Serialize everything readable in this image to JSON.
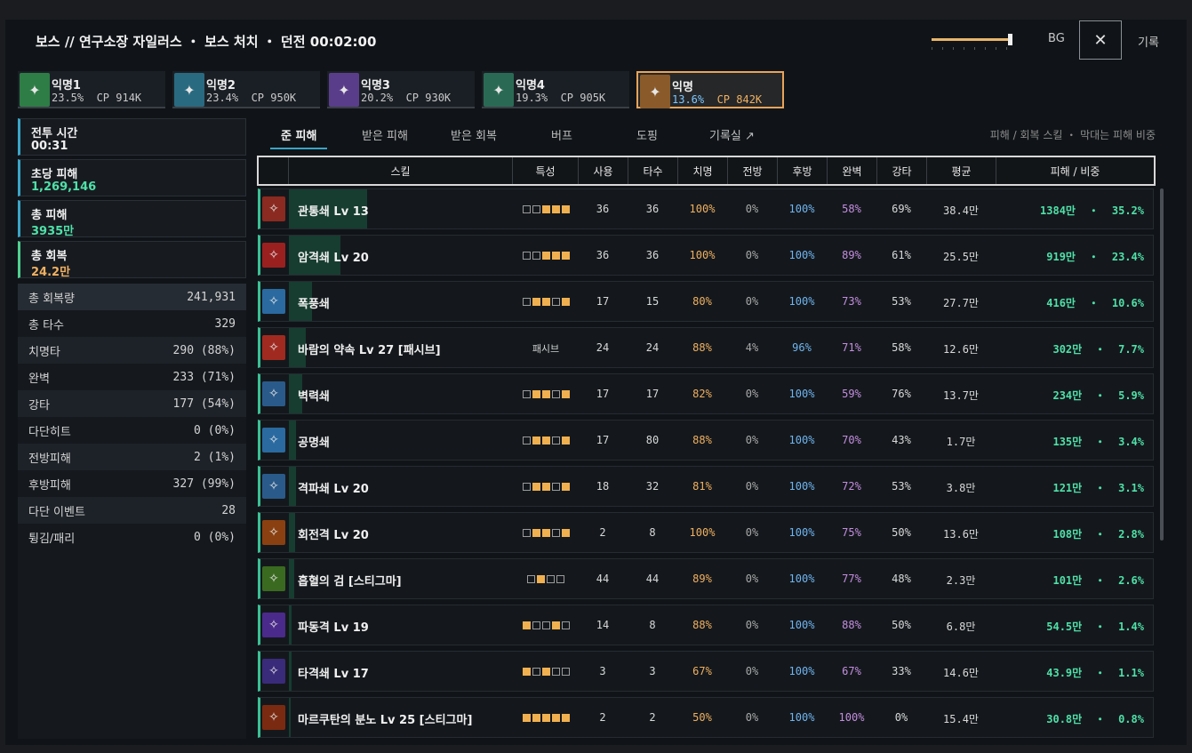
{
  "header": {
    "title": "보스 // 연구소장 자일러스 ・ 보스 처치 ・ 던전 00:02:00",
    "bg_label": "BG",
    "close_glyph": "✕",
    "record_label": "기록",
    "bg_slider_value": 0.95
  },
  "players": [
    {
      "name": "익명1",
      "stats": "23.5%  CP 914K",
      "color": "#2e7d46",
      "icon": "crest-icon"
    },
    {
      "name": "익명2",
      "stats": "23.4%  CP 950K",
      "color": "#2a6a80",
      "icon": "crest-icon"
    },
    {
      "name": "익명3",
      "stats": "20.2%  CP 930K",
      "color": "#5a3d8a",
      "icon": "crest-icon"
    },
    {
      "name": "익명4",
      "stats": "19.3%  CP 905K",
      "color": "#2a6a55",
      "icon": "crest-icon"
    },
    {
      "name": "익명",
      "pct": "13.6%",
      "cp": "CP 842K",
      "color": "#8a5a2a",
      "icon": "crest-icon",
      "selected": true
    }
  ],
  "summary": [
    {
      "label": "전투 시간",
      "value": "00:31",
      "color": "#f0f0f0",
      "accent": "#3aa5c8"
    },
    {
      "label": "초당 피해",
      "value": "1,269,146",
      "color": "#4fe0a8",
      "accent": "#3aa5c8"
    },
    {
      "label": "총 피해",
      "value": "3935만",
      "color": "#4fe0a8",
      "accent": "#3aa5c8"
    },
    {
      "label": "총 회복",
      "value": "24.2만",
      "color": "#f0b060",
      "accent": "#4fcf90"
    }
  ],
  "stats": [
    {
      "label": "총 회복량",
      "value": "241,931"
    },
    {
      "label": "총 타수",
      "value": "329"
    },
    {
      "label": "치명타",
      "value": "290 (88%)"
    },
    {
      "label": "완벽",
      "value": "233 (71%)"
    },
    {
      "label": "강타",
      "value": "177 (54%)"
    },
    {
      "label": "다단히트",
      "value": "0 (0%)"
    },
    {
      "label": "전방피해",
      "value": "2 (1%)"
    },
    {
      "label": "후방피해",
      "value": "327 (99%)"
    },
    {
      "label": "다단 이벤트",
      "value": "28"
    },
    {
      "label": "튕김/패리",
      "value": "0 (0%)"
    }
  ],
  "tabs": [
    "준 피해",
    "받은 피해",
    "받은 회복",
    "버프",
    "도핑",
    "기록실 ↗"
  ],
  "tab_right": "피해 / 회복 스킬  ・  막대는 피해 비중",
  "columns": [
    "스킬",
    "특성",
    "사용",
    "타수",
    "치명",
    "전방",
    "후방",
    "완벽",
    "강타",
    "평균",
    "피해 / 비중"
  ],
  "skills": [
    {
      "name": "관통쇄   Lv 13",
      "trait": [
        0,
        0,
        1,
        1,
        1
      ],
      "use": "36",
      "hits": "36",
      "crit": "100%",
      "front": "0%",
      "back": "100%",
      "perfect": "58%",
      "strong": "69%",
      "avg": "38.4만",
      "dmg": "1384만  ・  35.2%",
      "share": 35.2,
      "iconColor": "#8a2a20",
      "icon": "slash-icon"
    },
    {
      "name": "암격쇄   Lv 20",
      "trait": [
        0,
        0,
        1,
        1,
        1
      ],
      "use": "36",
      "hits": "36",
      "crit": "100%",
      "front": "0%",
      "back": "100%",
      "perfect": "89%",
      "strong": "61%",
      "avg": "25.5만",
      "dmg": "919만  ・  23.4%",
      "share": 23.4,
      "iconColor": "#9a2020",
      "icon": "claw-icon"
    },
    {
      "name": "폭풍쇄",
      "trait": [
        0,
        1,
        1,
        0,
        1
      ],
      "use": "17",
      "hits": "15",
      "crit": "80%",
      "front": "0%",
      "back": "100%",
      "perfect": "73%",
      "strong": "53%",
      "avg": "27.7만",
      "dmg": "416만  ・  10.6%",
      "share": 10.6,
      "iconColor": "#2a6aa0",
      "icon": "wave-icon"
    },
    {
      "name": "바람의 약속   Lv 27 [패시브]",
      "traitText": "패시브",
      "use": "24",
      "hits": "24",
      "crit": "88%",
      "front": "4%",
      "back": "96%",
      "perfect": "71%",
      "strong": "58%",
      "avg": "12.6만",
      "dmg": "302만  ・  7.7%",
      "share": 7.7,
      "iconColor": "#a02a20",
      "icon": "flame-icon"
    },
    {
      "name": "벽력쇄",
      "trait": [
        0,
        1,
        1,
        0,
        1
      ],
      "use": "17",
      "hits": "17",
      "crit": "82%",
      "front": "0%",
      "back": "100%",
      "perfect": "59%",
      "strong": "76%",
      "avg": "13.7만",
      "dmg": "234만  ・  5.9%",
      "share": 5.9,
      "iconColor": "#2a5a8a",
      "icon": "bolt-icon"
    },
    {
      "name": "공명쇄",
      "trait": [
        0,
        1,
        1,
        0,
        1
      ],
      "use": "17",
      "hits": "80",
      "crit": "88%",
      "front": "0%",
      "back": "100%",
      "perfect": "70%",
      "strong": "43%",
      "avg": "1.7만",
      "dmg": "135만  ・  3.4%",
      "share": 3.4,
      "iconColor": "#2a6aa0",
      "icon": "wave-icon"
    },
    {
      "name": "격파쇄   Lv 20",
      "trait": [
        0,
        1,
        1,
        0,
        1
      ],
      "use": "18",
      "hits": "32",
      "crit": "81%",
      "front": "0%",
      "back": "100%",
      "perfect": "72%",
      "strong": "53%",
      "avg": "3.8만",
      "dmg": "121만  ・  3.1%",
      "share": 3.1,
      "iconColor": "#2a5a8a",
      "icon": "strike-icon"
    },
    {
      "name": "회전격   Lv 20",
      "trait": [
        0,
        1,
        1,
        0,
        1
      ],
      "use": "2",
      "hits": "8",
      "crit": "100%",
      "front": "0%",
      "back": "100%",
      "perfect": "75%",
      "strong": "50%",
      "avg": "13.6만",
      "dmg": "108만  ・  2.8%",
      "share": 2.8,
      "iconColor": "#8a4010",
      "icon": "ring-icon"
    },
    {
      "name": "흡혈의 검  [스티그마]",
      "trait": [
        0,
        1,
        0,
        0
      ],
      "use": "44",
      "hits": "44",
      "crit": "89%",
      "front": "0%",
      "back": "100%",
      "perfect": "77%",
      "strong": "48%",
      "avg": "2.3만",
      "dmg": "101만  ・  2.6%",
      "share": 2.6,
      "iconColor": "#3a6a20",
      "icon": "sword-icon"
    },
    {
      "name": "파동격   Lv 19",
      "trait": [
        1,
        0,
        0,
        1,
        0
      ],
      "use": "14",
      "hits": "8",
      "crit": "88%",
      "front": "0%",
      "back": "100%",
      "perfect": "88%",
      "strong": "50%",
      "avg": "6.8만",
      "dmg": "54.5만  ・  1.4%",
      "share": 1.4,
      "iconColor": "#4a2a8a",
      "icon": "pulse-icon"
    },
    {
      "name": "타격쇄   Lv 17",
      "trait": [
        1,
        0,
        1,
        0,
        0
      ],
      "use": "3",
      "hits": "3",
      "crit": "67%",
      "front": "0%",
      "back": "100%",
      "perfect": "67%",
      "strong": "33%",
      "avg": "14.6만",
      "dmg": "43.9만  ・  1.1%",
      "share": 1.1,
      "iconColor": "#3a2a7a",
      "icon": "orb-icon"
    },
    {
      "name": "마르쿠탄의 분노   Lv 25 [스티그마]",
      "trait": [
        1,
        1,
        1,
        1,
        1
      ],
      "use": "2",
      "hits": "2",
      "crit": "50%",
      "front": "0%",
      "back": "100%",
      "perfect": "100%",
      "strong": "0%",
      "avg": "15.4만",
      "dmg": "30.8만  ・  0.8%",
      "share": 0.8,
      "iconColor": "#7a2a10",
      "icon": "flame-icon"
    }
  ]
}
